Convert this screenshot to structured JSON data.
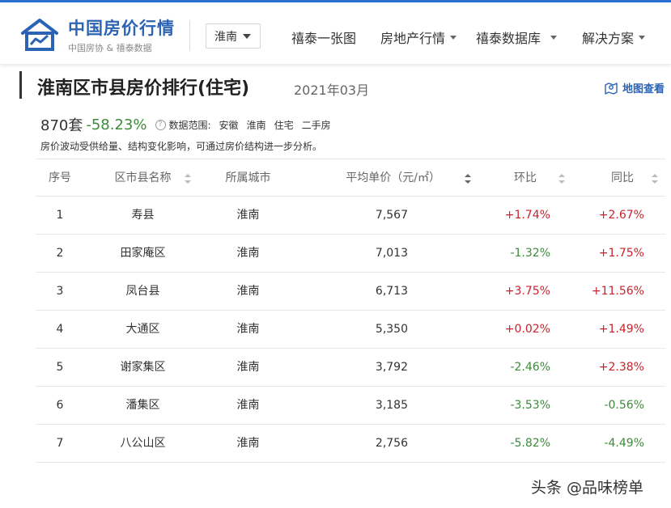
{
  "header": {
    "brand_title": "中国房价行情",
    "brand_sub": "中国房协 & 禧泰数据",
    "city_selected": "淮南",
    "nav": [
      {
        "label": "禧泰一张图",
        "has_dropdown": false
      },
      {
        "label": "房地产行情",
        "has_dropdown": true
      },
      {
        "label": "禧泰数据库",
        "has_dropdown": true
      },
      {
        "label": "解决方案",
        "has_dropdown": true
      }
    ]
  },
  "page": {
    "title": "淮南区市县房价排行(住宅)",
    "date": "2021年03月",
    "map_link": "地图查看"
  },
  "stats": {
    "count": "870套",
    "change": "-58.23%",
    "range_label": "数据范围:",
    "range_items": [
      "安徽",
      "淮南",
      "住宅",
      "二手房"
    ],
    "note": "房价波动受供给量、结构变化影响，可通过房价结构进一步分析。"
  },
  "table": {
    "columns": [
      "序号",
      "区市县名称",
      "所属城市",
      "平均单价（元/㎡）",
      "环比",
      "同比"
    ],
    "rows": [
      {
        "no": "1",
        "name": "寿县",
        "city": "淮南",
        "price": "7,567",
        "mom": "+1.74%",
        "yoy": "+2.67%"
      },
      {
        "no": "2",
        "name": "田家庵区",
        "city": "淮南",
        "price": "7,013",
        "mom": "-1.32%",
        "yoy": "+1.75%"
      },
      {
        "no": "3",
        "name": "凤台县",
        "city": "淮南",
        "price": "6,713",
        "mom": "+3.75%",
        "yoy": "+11.56%"
      },
      {
        "no": "4",
        "name": "大通区",
        "city": "淮南",
        "price": "5,350",
        "mom": "+0.02%",
        "yoy": "+1.49%"
      },
      {
        "no": "5",
        "name": "谢家集区",
        "city": "淮南",
        "price": "3,792",
        "mom": "-2.46%",
        "yoy": "+2.38%"
      },
      {
        "no": "6",
        "name": "潘集区",
        "city": "淮南",
        "price": "3,185",
        "mom": "-3.53%",
        "yoy": "-0.56%"
      },
      {
        "no": "7",
        "name": "八公山区",
        "city": "淮南",
        "price": "2,756",
        "mom": "-5.82%",
        "yoy": "-4.49%"
      }
    ]
  },
  "colors": {
    "brand": "#2b63b5",
    "positive": "#c8232c",
    "negative": "#3c8a3a"
  },
  "icons": {
    "logo": "house-chart-icon",
    "map": "map-pin-icon",
    "help": "question-circle-icon",
    "sort": "sort-arrows-icon"
  },
  "watermark": "头条 @品味榜单"
}
